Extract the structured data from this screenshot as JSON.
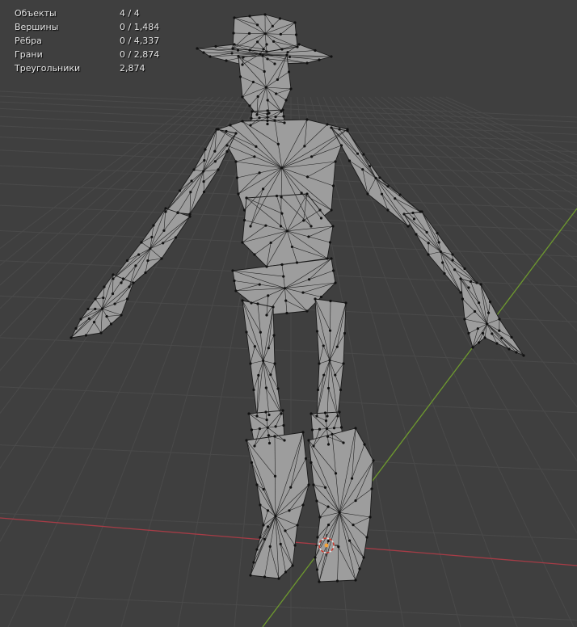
{
  "viewport": {
    "background": "#3f3f3f",
    "grid_color": "#4a4a4a",
    "x_axis_color": "#a63c46",
    "y_axis_color": "#6e9a2e",
    "mesh_fill": "#9d9d9d",
    "mesh_wire": "#1a1a1a"
  },
  "stats": {
    "objects": {
      "label": "Объекты",
      "value": "4 / 4"
    },
    "vertices": {
      "label": "Вершины",
      "value": "0 / 1,484"
    },
    "edges": {
      "label": "Рёбра",
      "value": "0 / 4,337"
    },
    "faces": {
      "label": "Грани",
      "value": "0 / 2,874"
    },
    "triangles": {
      "label": "Треугольники",
      "value": "2,874"
    }
  },
  "icons": {
    "origin": "3d-cursor-icon"
  }
}
